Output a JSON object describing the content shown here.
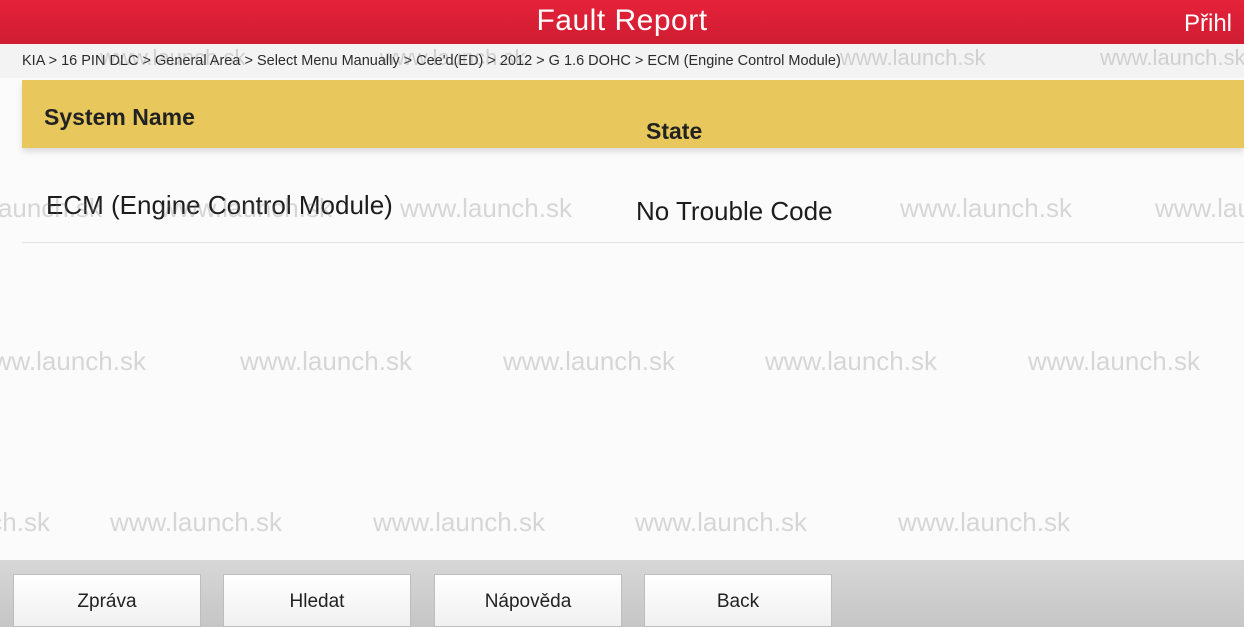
{
  "header": {
    "title": "Fault Report",
    "login_label": "Přihl"
  },
  "breadcrumb": "KIA > 16 PIN DLC > General Area > Select Menu Manually > Cee'd(ED) > 2012 > G 1.6 DOHC > ECM (Engine Control Module)",
  "table": {
    "columns": {
      "system": "System Name",
      "state": "State"
    },
    "rows": [
      {
        "system": "ECM (Engine Control Module)",
        "state": "No Trouble Code"
      }
    ]
  },
  "watermark": {
    "text": "www.launch.sk",
    "rows": [
      [
        "www.launch.sk",
        "www.launch.sk",
        "www.launch.sk",
        "www.launch.sk"
      ],
      [
        "www.launch.sk",
        "www.launch.sk",
        "www.launch.sk",
        "www.launch.sk",
        "www.launch.sk"
      ],
      [
        "www.launch.sk",
        "www.launch.sk",
        "www.launch.sk",
        "www.launch.sk",
        "www.launch.sk"
      ],
      [
        "www.launch.sk",
        "www.launch.sk",
        "www.launch.sk",
        "www.launch.sk",
        "www.launch.sk"
      ]
    ]
  },
  "footer": {
    "buttons": [
      "Zpráva",
      "Hledat",
      "Nápověda",
      "Back"
    ]
  }
}
